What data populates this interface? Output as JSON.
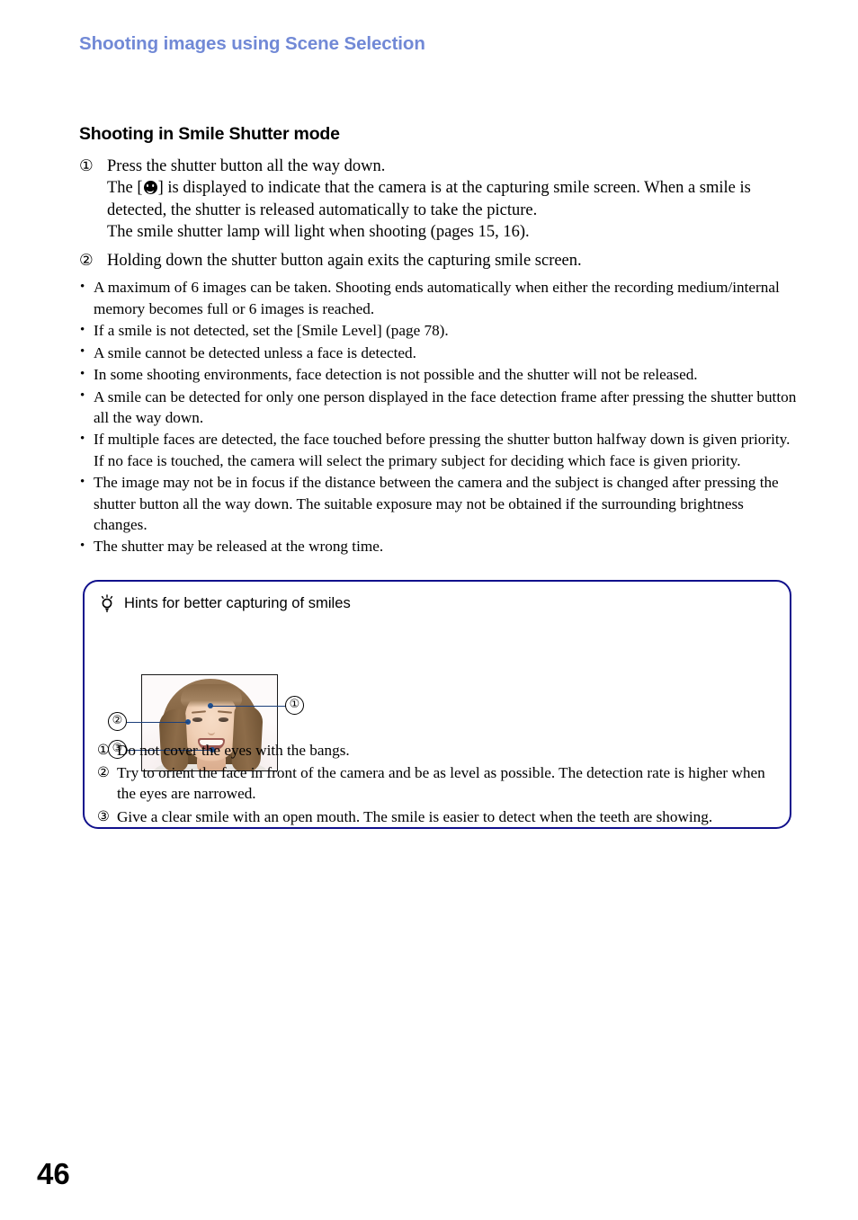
{
  "header": {
    "running_title": "Shooting images using Scene Selection"
  },
  "section": {
    "title": "Shooting in Smile Shutter mode"
  },
  "steps": [
    {
      "marker": "①",
      "lines": [
        "Press the shutter button all the way down.",
        "The [   ] is displayed to indicate that the camera is at the capturing smile screen. When a smile is detected, the shutter is released automatically to take the picture.",
        "The smile shutter lamp will light when shooting (pages 15, 16)."
      ],
      "line1": "Press the shutter button all the way down.",
      "line2_before_icon": "The [",
      "line2_after_icon": "] is displayed to indicate that the camera is at the capturing smile screen. When a smile is detected, the shutter is released automatically to take the picture.",
      "line3": "The smile shutter lamp will light when shooting (pages 15, 16)."
    },
    {
      "marker": "②",
      "line1": "Holding down the shutter button again exits the capturing smile screen."
    }
  ],
  "notes": [
    "A maximum of 6 images can be taken. Shooting ends automatically when either the recording medium/internal memory becomes full or 6 images is reached.",
    "If a smile is not detected, set the [Smile Level] (page 78).",
    "A smile cannot be detected unless a face is detected.",
    "In some shooting environments, face detection is not possible and the shutter will not be released.",
    "A smile can be detected for only one person displayed in the face detection frame after pressing the shutter button all the way down.",
    "If multiple faces are detected, the face touched before pressing the shutter button halfway down is given priority. If no face is touched, the camera will select the primary subject for deciding which face is given priority.",
    "The image may not be in focus if the distance between the camera and the subject is changed after pressing the shutter button all the way down. The suitable exposure may not be obtained if the surrounding brightness changes.",
    "The shutter may be released at the wrong time."
  ],
  "hint_box": {
    "title": "Hints for better capturing of smiles",
    "icon": "lightbulb-icon",
    "border_color": "#10108c",
    "callouts": [
      {
        "marker": "①",
        "target": "forehead"
      },
      {
        "marker": "②",
        "target": "eyes"
      },
      {
        "marker": "③",
        "target": "mouth"
      }
    ],
    "items": [
      {
        "marker": "①",
        "text": "Do not cover the eyes with the bangs."
      },
      {
        "marker": "②",
        "text": "Try to orient the face in front of the camera and be as level as possible. The detection rate is higher when the eyes are narrowed."
      },
      {
        "marker": "③",
        "text": "Give a clear smile with an open mouth. The smile is easier to detect when the teeth are showing."
      }
    ]
  },
  "footer": {
    "page_number": "46"
  },
  "colors": {
    "running_header": "#7189d6",
    "hint_border": "#10108c",
    "callout_line": "#1b3f7a",
    "callout_dot": "#1e4f8f"
  }
}
